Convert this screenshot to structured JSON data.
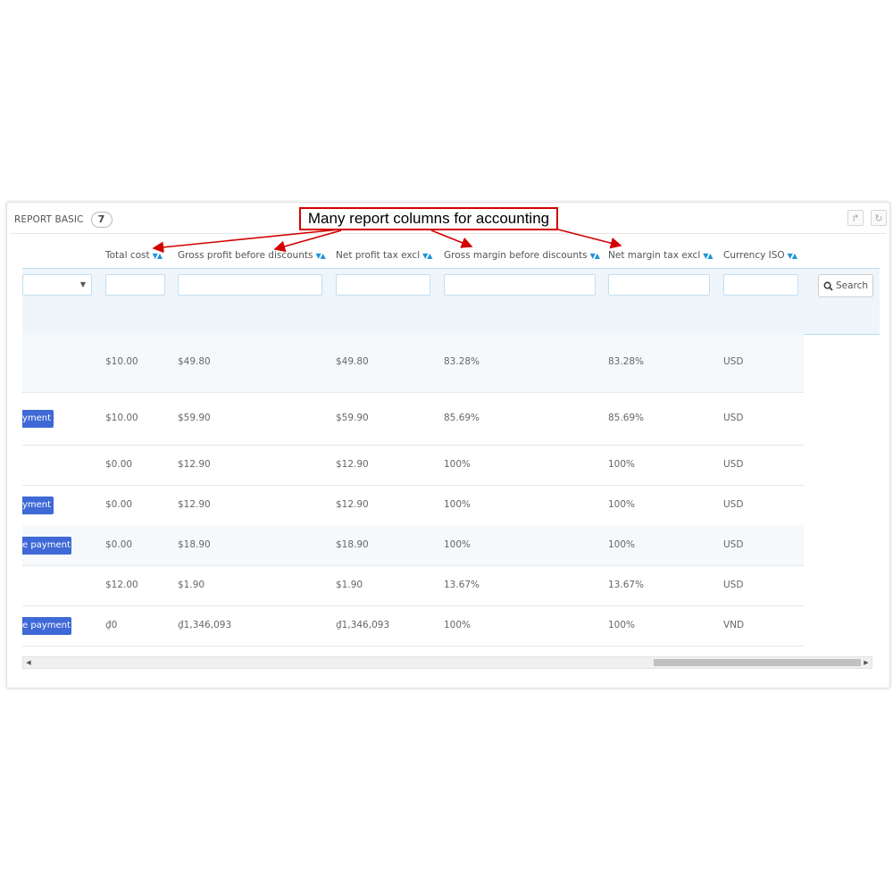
{
  "panel": {
    "title": "REPORT BASIC",
    "count": "7"
  },
  "annotation": {
    "text": "Many report columns for accounting",
    "color": "#d40000"
  },
  "columns": [
    {
      "label": "Total cost"
    },
    {
      "label": "Gross profit before discounts"
    },
    {
      "label": "Net profit tax excl"
    },
    {
      "label": "Gross margin before discounts"
    },
    {
      "label": "Net margin tax excl"
    },
    {
      "label": "Currency ISO"
    }
  ],
  "filters": {
    "select_value": "",
    "search_label": "Search"
  },
  "rows": [
    {
      "action": "",
      "total_cost": "$10.00",
      "gross_profit": "$49.80",
      "net_profit": "$49.80",
      "gross_margin": "83.28%",
      "net_margin": "83.28%",
      "currency": "USD"
    },
    {
      "action": "yment",
      "total_cost": "$10.00",
      "gross_profit": "$59.90",
      "net_profit": "$59.90",
      "gross_margin": "85.69%",
      "net_margin": "85.69%",
      "currency": "USD"
    },
    {
      "action": "",
      "total_cost": "$0.00",
      "gross_profit": "$12.90",
      "net_profit": "$12.90",
      "gross_margin": "100%",
      "net_margin": "100%",
      "currency": "USD"
    },
    {
      "action": "yment",
      "total_cost": "$0.00",
      "gross_profit": "$12.90",
      "net_profit": "$12.90",
      "gross_margin": "100%",
      "net_margin": "100%",
      "currency": "USD"
    },
    {
      "action": "e payment",
      "total_cost": "$0.00",
      "gross_profit": "$18.90",
      "net_profit": "$18.90",
      "gross_margin": "100%",
      "net_margin": "100%",
      "currency": "USD"
    },
    {
      "action": "",
      "total_cost": "$12.00",
      "gross_profit": "$1.90",
      "net_profit": "$1.90",
      "gross_margin": "13.67%",
      "net_margin": "13.67%",
      "currency": "USD"
    },
    {
      "action": "e payment",
      "total_cost": "₫0",
      "gross_profit": "₫1,346,093",
      "net_profit": "₫1,346,093",
      "gross_margin": "100%",
      "net_margin": "100%",
      "currency": "VND"
    }
  ],
  "colors": {
    "accent": "#1e94d6",
    "button": "#3f69d6",
    "filter_band": "#eef5fb"
  }
}
